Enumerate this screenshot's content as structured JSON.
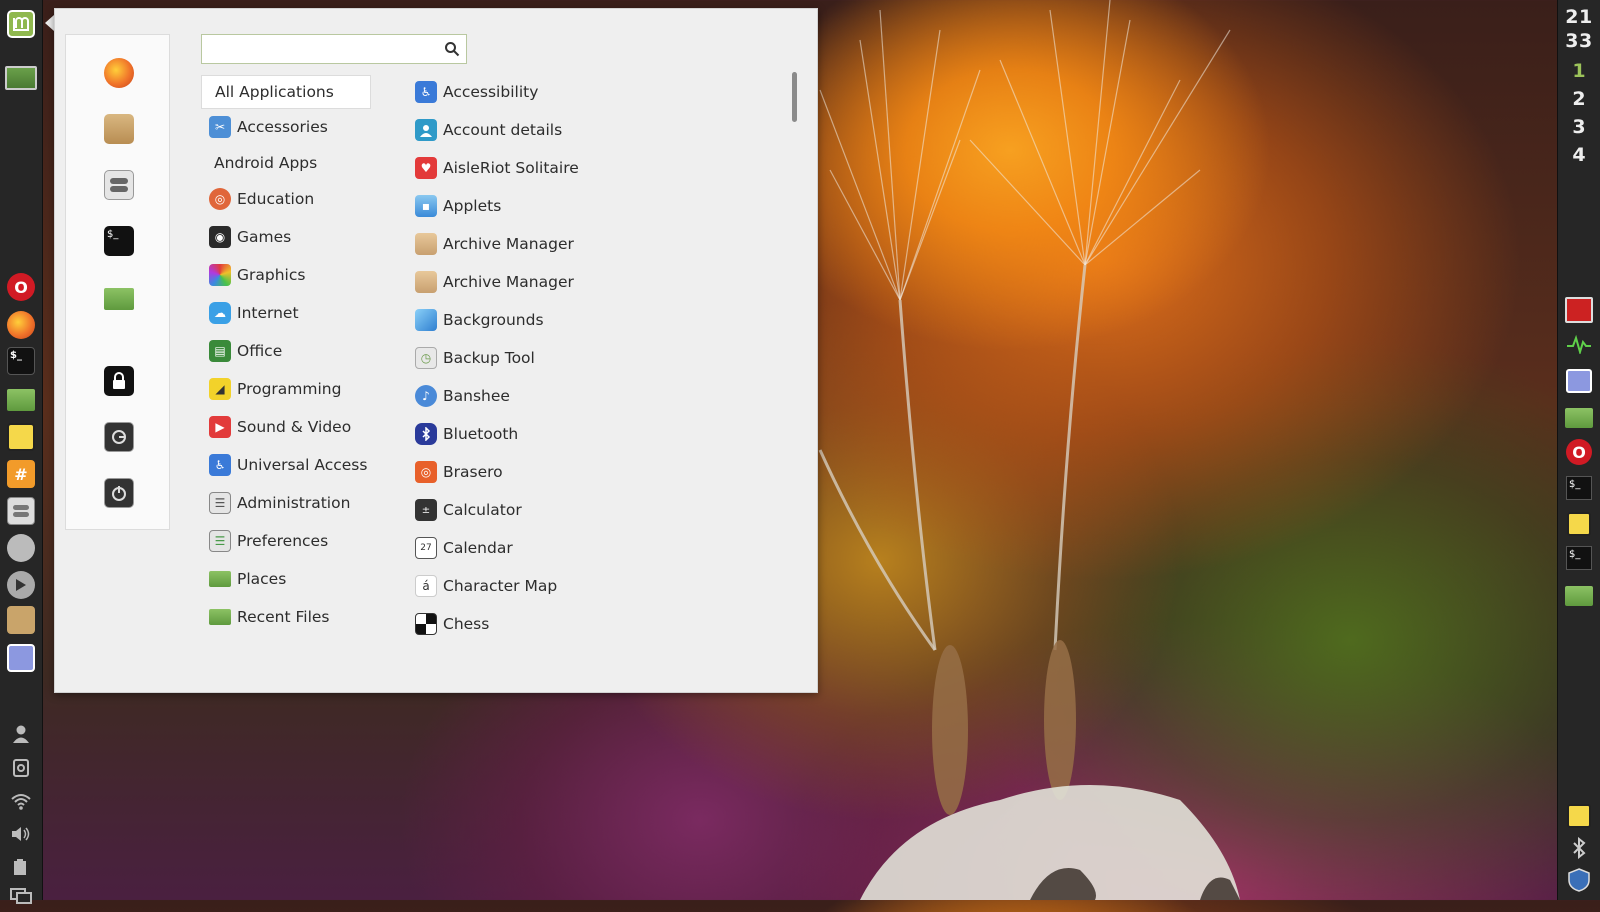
{
  "clock": {
    "hours": "21",
    "minutes": "33"
  },
  "workspaces": [
    "1",
    "2",
    "3",
    "4"
  ],
  "search": {
    "value": "",
    "placeholder": ""
  },
  "categories": [
    {
      "label": "All Applications",
      "selected": true
    },
    {
      "label": "Accessories",
      "icon": "accessories-icon"
    },
    {
      "label": "Android Apps"
    },
    {
      "label": "Education",
      "icon": "education-icon"
    },
    {
      "label": "Games",
      "icon": "games-icon"
    },
    {
      "label": "Graphics",
      "icon": "graphics-icon"
    },
    {
      "label": "Internet",
      "icon": "internet-icon"
    },
    {
      "label": "Office",
      "icon": "office-icon"
    },
    {
      "label": "Programming",
      "icon": "programming-icon"
    },
    {
      "label": "Sound & Video",
      "icon": "sound-video-icon"
    },
    {
      "label": "Universal Access",
      "icon": "universal-access-icon"
    },
    {
      "label": "Administration",
      "icon": "administration-icon"
    },
    {
      "label": "Preferences",
      "icon": "preferences-icon"
    },
    {
      "label": "Places",
      "icon": "folder-icon"
    },
    {
      "label": "Recent Files",
      "icon": "recent-files-icon"
    }
  ],
  "apps": [
    {
      "label": "Accessibility",
      "icon": "accessibility-icon"
    },
    {
      "label": "Account details",
      "icon": "account-icon"
    },
    {
      "label": "AisleRiot Solitaire",
      "icon": "solitaire-icon"
    },
    {
      "label": "Applets",
      "icon": "applets-icon"
    },
    {
      "label": "Archive Manager",
      "icon": "archive-icon"
    },
    {
      "label": "Archive Manager",
      "icon": "archive-icon"
    },
    {
      "label": "Backgrounds",
      "icon": "backgrounds-icon"
    },
    {
      "label": "Backup Tool",
      "icon": "backup-icon"
    },
    {
      "label": "Banshee",
      "icon": "banshee-icon"
    },
    {
      "label": "Bluetooth",
      "icon": "bluetooth-icon"
    },
    {
      "label": "Brasero",
      "icon": "brasero-icon"
    },
    {
      "label": "Calculator",
      "icon": "calculator-icon"
    },
    {
      "label": "Calendar",
      "icon": "calendar-icon"
    },
    {
      "label": "Character Map",
      "icon": "character-map-icon"
    },
    {
      "label": "Chess",
      "icon": "chess-icon"
    }
  ],
  "icon_glyphs": {
    "calendar": "27",
    "character_map": "á",
    "terminal": "$_",
    "hash": "#",
    "opera": "O"
  },
  "colors": {
    "accent_green": "#8fb84e",
    "firefox_orange": "#f0742a",
    "opera_red": "#d11a24"
  }
}
